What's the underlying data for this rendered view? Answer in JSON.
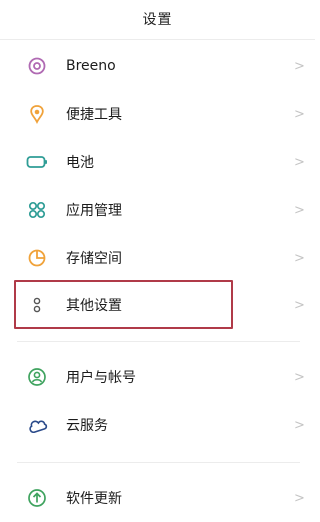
{
  "header": {
    "title": "设置"
  },
  "items": [
    {
      "label": "Breeno",
      "icon": "breeno-icon",
      "color": "#b06ab3"
    },
    {
      "label": "便捷工具",
      "icon": "tools-icon",
      "color": "#f0a23a"
    },
    {
      "label": "电池",
      "icon": "battery-icon",
      "color": "#2f9d96"
    },
    {
      "label": "应用管理",
      "icon": "apps-icon",
      "color": "#2f9d96"
    },
    {
      "label": "存储空间",
      "icon": "storage-icon",
      "color": "#f0a23a"
    },
    {
      "label": "其他设置",
      "icon": "more-settings-icon",
      "color": "#555555"
    },
    {
      "label": "用户与帐号",
      "icon": "user-account-icon",
      "color": "#3fa35f"
    },
    {
      "label": "云服务",
      "icon": "cloud-icon",
      "color": "#2a4a8a"
    },
    {
      "label": "软件更新",
      "icon": "update-icon",
      "color": "#3fa35f"
    }
  ],
  "chevron": ">",
  "highlight_color": "#b03a48"
}
